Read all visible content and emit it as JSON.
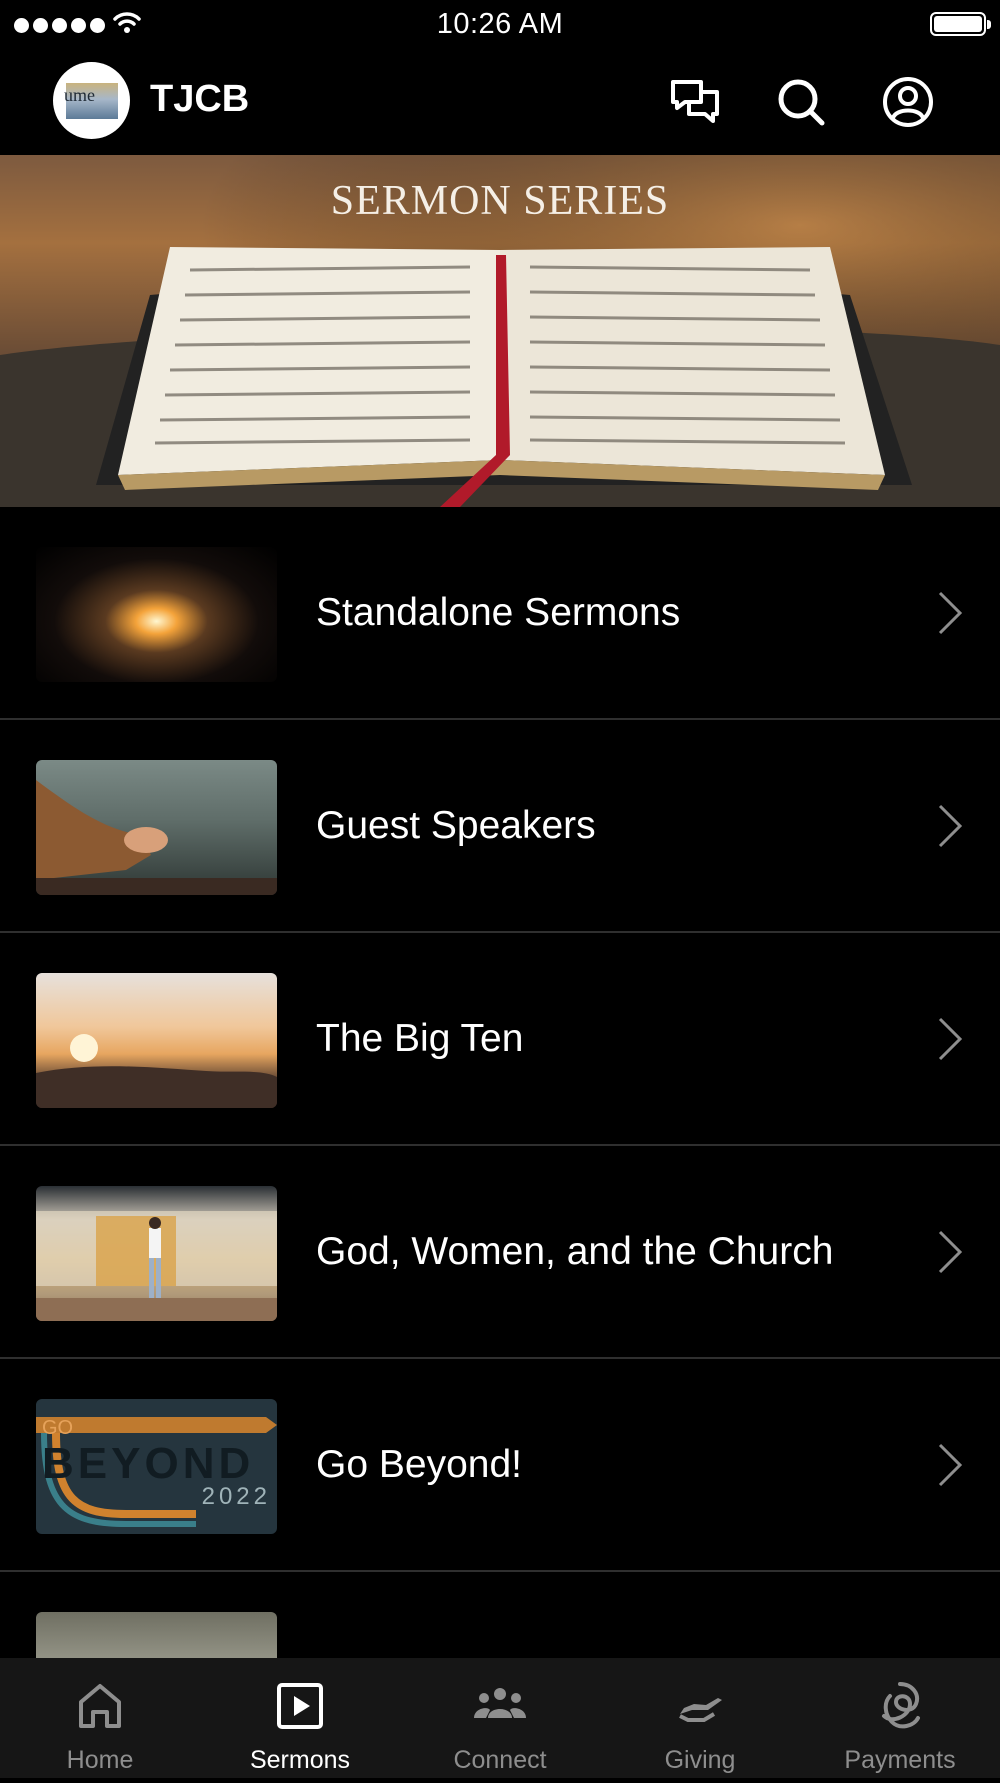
{
  "status_bar": {
    "time": "10:26 AM"
  },
  "header": {
    "logo_text": "ume",
    "title": "TJCB",
    "icons": [
      "chat-icon",
      "search-icon",
      "account-icon"
    ]
  },
  "banner": {
    "title": "SERMON SERIES"
  },
  "series": [
    {
      "label": "Standalone Sermons",
      "thumb": "cave-light"
    },
    {
      "label": "Guest Speakers",
      "thumb": "praying-hands"
    },
    {
      "label": "The Big Ten",
      "thumb": "sunrise"
    },
    {
      "label": "God, Women, and the Church",
      "thumb": "train-platform"
    },
    {
      "label": "Go Beyond!",
      "thumb": "go-beyond-2022",
      "thumb_text": {
        "go": "GO",
        "beyond": "BEYOND",
        "year": "2022"
      }
    },
    {
      "label": "",
      "thumb": "field"
    }
  ],
  "tabs": [
    {
      "label": "Home",
      "icon": "home-icon",
      "active": false
    },
    {
      "label": "Sermons",
      "icon": "play-icon",
      "active": true
    },
    {
      "label": "Connect",
      "icon": "people-icon",
      "active": false
    },
    {
      "label": "Giving",
      "icon": "giving-hand-icon",
      "active": false
    },
    {
      "label": "Payments",
      "icon": "payments-icon",
      "active": false
    }
  ],
  "colors": {
    "background": "#000000",
    "tab_bar": "#161616",
    "tab_inactive": "#8e8e8e",
    "divider": "#2f2f2f"
  }
}
